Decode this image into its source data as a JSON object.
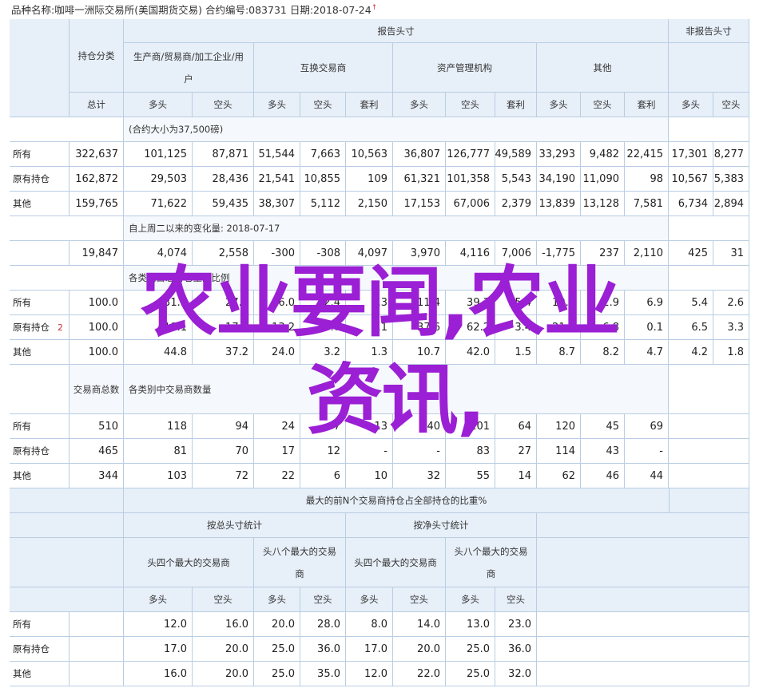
{
  "header": {
    "text": "品种名称:咖啡一洲际交易所(美国期货交易)  合约编号:083731  日期:2018-07-24",
    "mark": "↑"
  },
  "labels": {
    "report": "报告头寸",
    "nonreport": "非报告头寸",
    "holding_class": "持仓分类",
    "producer": "生产商/贸易商/加工企业/用户",
    "swap": "互换交易商",
    "managed": "资产管理机构",
    "other": "其他",
    "total": "总计",
    "long": "多头",
    "short": "空头",
    "spread": "套利",
    "row_all": "所有",
    "row_old": "原有持仓",
    "row_other": "其他",
    "note_contract": "(合约大小为37,500磅)",
    "note_change": "自上周二以来的变化量: 2018-07-17",
    "note_pct": "各类别占总持仓量的比例",
    "traders_total": "交易商总数",
    "note_traders": "各类别中交易商数量",
    "conc_title": "最大的前N个交易商持仓占全部持仓的比重%",
    "gross": "按总头寸统计",
    "net": "按净头寸统计",
    "top4": "头四个最大的交易商",
    "top8": "头八个最大的交易商"
  },
  "oi_rows": [
    [
      "322,637",
      "101,125",
      "87,871",
      "51,544",
      "7,663",
      "10,563",
      "36,807",
      "126,777",
      "49,589",
      "33,293",
      "9,482",
      "22,415",
      "17,301",
      "8,277"
    ],
    [
      "162,872",
      "29,503",
      "28,436",
      "21,541",
      "10,855",
      "109",
      "61,321",
      "101,358",
      "5,543",
      "34,190",
      "11,090",
      "98",
      "10,567",
      "5,383"
    ],
    [
      "159,765",
      "71,622",
      "59,435",
      "38,307",
      "5,112",
      "2,150",
      "17,153",
      "67,006",
      "2,379",
      "13,839",
      "13,128",
      "7,581",
      "6,734",
      "2,894"
    ]
  ],
  "change_row": [
    "19,847",
    "4,074",
    "2,558",
    "-300",
    "-308",
    "4,097",
    "3,970",
    "4,116",
    "7,006",
    "-1,775",
    "237",
    "2,110",
    "425",
    "31"
  ],
  "pct_rows": [
    [
      "100.0",
      "31.3",
      "27.2",
      "16.0",
      "2.4",
      "3.3",
      "11.4",
      "39.3",
      "15.4",
      "10.3",
      "2.9",
      "6.9",
      "5.4",
      "2.6"
    ],
    [
      "100.0",
      "18.1",
      "17.5",
      "13.2",
      "6.7",
      "0.1",
      "37.6",
      "62.2",
      "3.4",
      "21.0",
      "6.8",
      "0.1",
      "6.5",
      "3.3"
    ],
    [
      "100.0",
      "44.8",
      "37.2",
      "24.0",
      "3.2",
      "1.3",
      "10.7",
      "42.0",
      "1.5",
      "8.7",
      "8.2",
      "4.7",
      "4.2",
      "1.8"
    ]
  ],
  "pct_mark": "2",
  "trader_rows": [
    [
      "510",
      "118",
      "94",
      "24",
      "7",
      "13",
      "40",
      "101",
      "64",
      "120",
      "45",
      "69"
    ],
    [
      "465",
      "81",
      "70",
      "17",
      "12",
      "-",
      "-",
      "83",
      "27",
      "114",
      "43",
      "-"
    ],
    [
      "344",
      "103",
      "72",
      "22",
      "6",
      "10",
      "32",
      "55",
      "14",
      "62",
      "46",
      "44"
    ]
  ],
  "conc_rows": [
    [
      "12.0",
      "16.0",
      "20.0",
      "28.0",
      "8.0",
      "14.0",
      "13.0",
      "23.0"
    ],
    [
      "17.0",
      "20.0",
      "25.0",
      "36.0",
      "17.0",
      "20.0",
      "25.0",
      "36.0"
    ],
    [
      "16.0",
      "20.0",
      "25.0",
      "35.0",
      "12.0",
      "22.0",
      "25.0",
      "32.0"
    ]
  ],
  "watermark": {
    "line1": "农业要闻,农业",
    "line2": "资讯,"
  }
}
